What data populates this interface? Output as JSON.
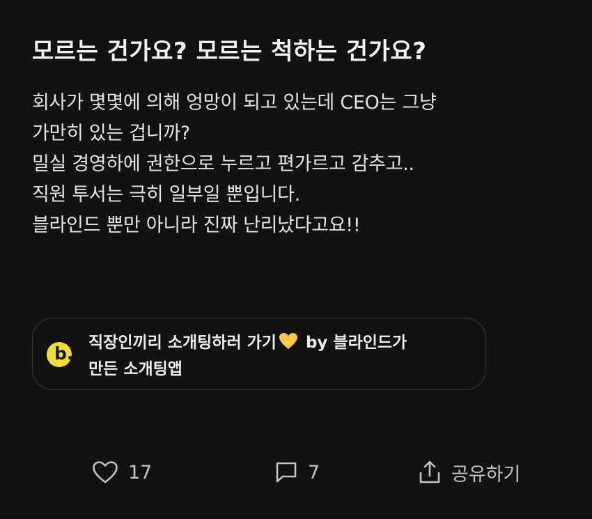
{
  "post": {
    "title": "모르는 건가요? 모르는 척하는 건가요?",
    "body_lines": [
      "회사가 몇몇에 의해 엉망이 되고 있는데 CEO는 그냥",
      "가만히 있는 겁니까?",
      "밀실 경영하에 권한으로 누르고 편가르고 감추고..",
      "직원 투서는 극히 일부일 뿐입니다.",
      "블라인드 뿐만 아니라 진짜 난리났다고요!!"
    ]
  },
  "ad": {
    "logo_letter": "b.",
    "line1_before": "직장인끼리 소개팅하러 가기",
    "line1_after": "by 블라인드가",
    "line2": "만든 소개팅앱",
    "logo_color": "#f2dd34",
    "heart_color": "#f7c948"
  },
  "actions": {
    "like_count": "17",
    "comment_count": "7",
    "share_label": "공유하기"
  }
}
